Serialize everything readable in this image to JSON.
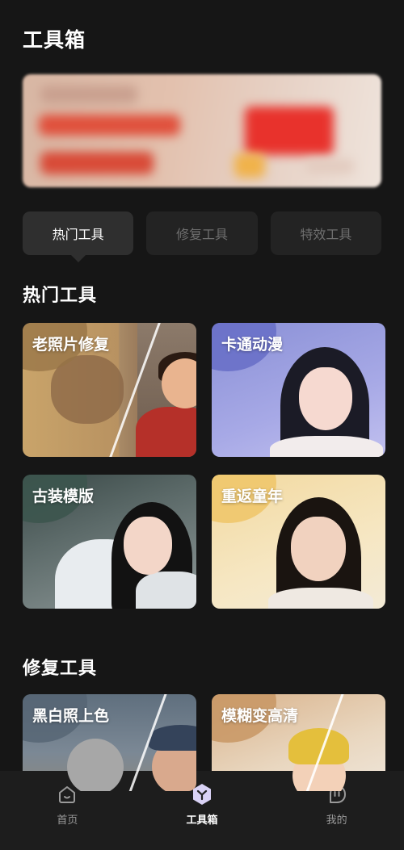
{
  "page": {
    "title": "工具箱"
  },
  "tabs": [
    {
      "label": "热门工具",
      "active": true
    },
    {
      "label": "修复工具",
      "active": false
    },
    {
      "label": "特效工具",
      "active": false
    }
  ],
  "sections": {
    "hot": {
      "title": "热门工具",
      "cards": [
        {
          "label": "老照片修复"
        },
        {
          "label": "卡通动漫"
        },
        {
          "label": "古装模版"
        },
        {
          "label": "重返童年"
        }
      ]
    },
    "repair": {
      "title": "修复工具",
      "cards": [
        {
          "label": "黑白照上色"
        },
        {
          "label": "模糊变高清"
        }
      ]
    }
  },
  "bottom_nav": {
    "items": [
      {
        "label": "首页",
        "icon": "home-icon",
        "active": false
      },
      {
        "label": "工具箱",
        "icon": "toolbox-icon",
        "active": true
      },
      {
        "label": "我的",
        "icon": "profile-icon",
        "active": false
      }
    ]
  },
  "colors": {
    "background": "#161616",
    "tab_active": "#2f2f2f",
    "tab_inactive": "#232323",
    "accent_toolbox": "#d9d2f5"
  }
}
